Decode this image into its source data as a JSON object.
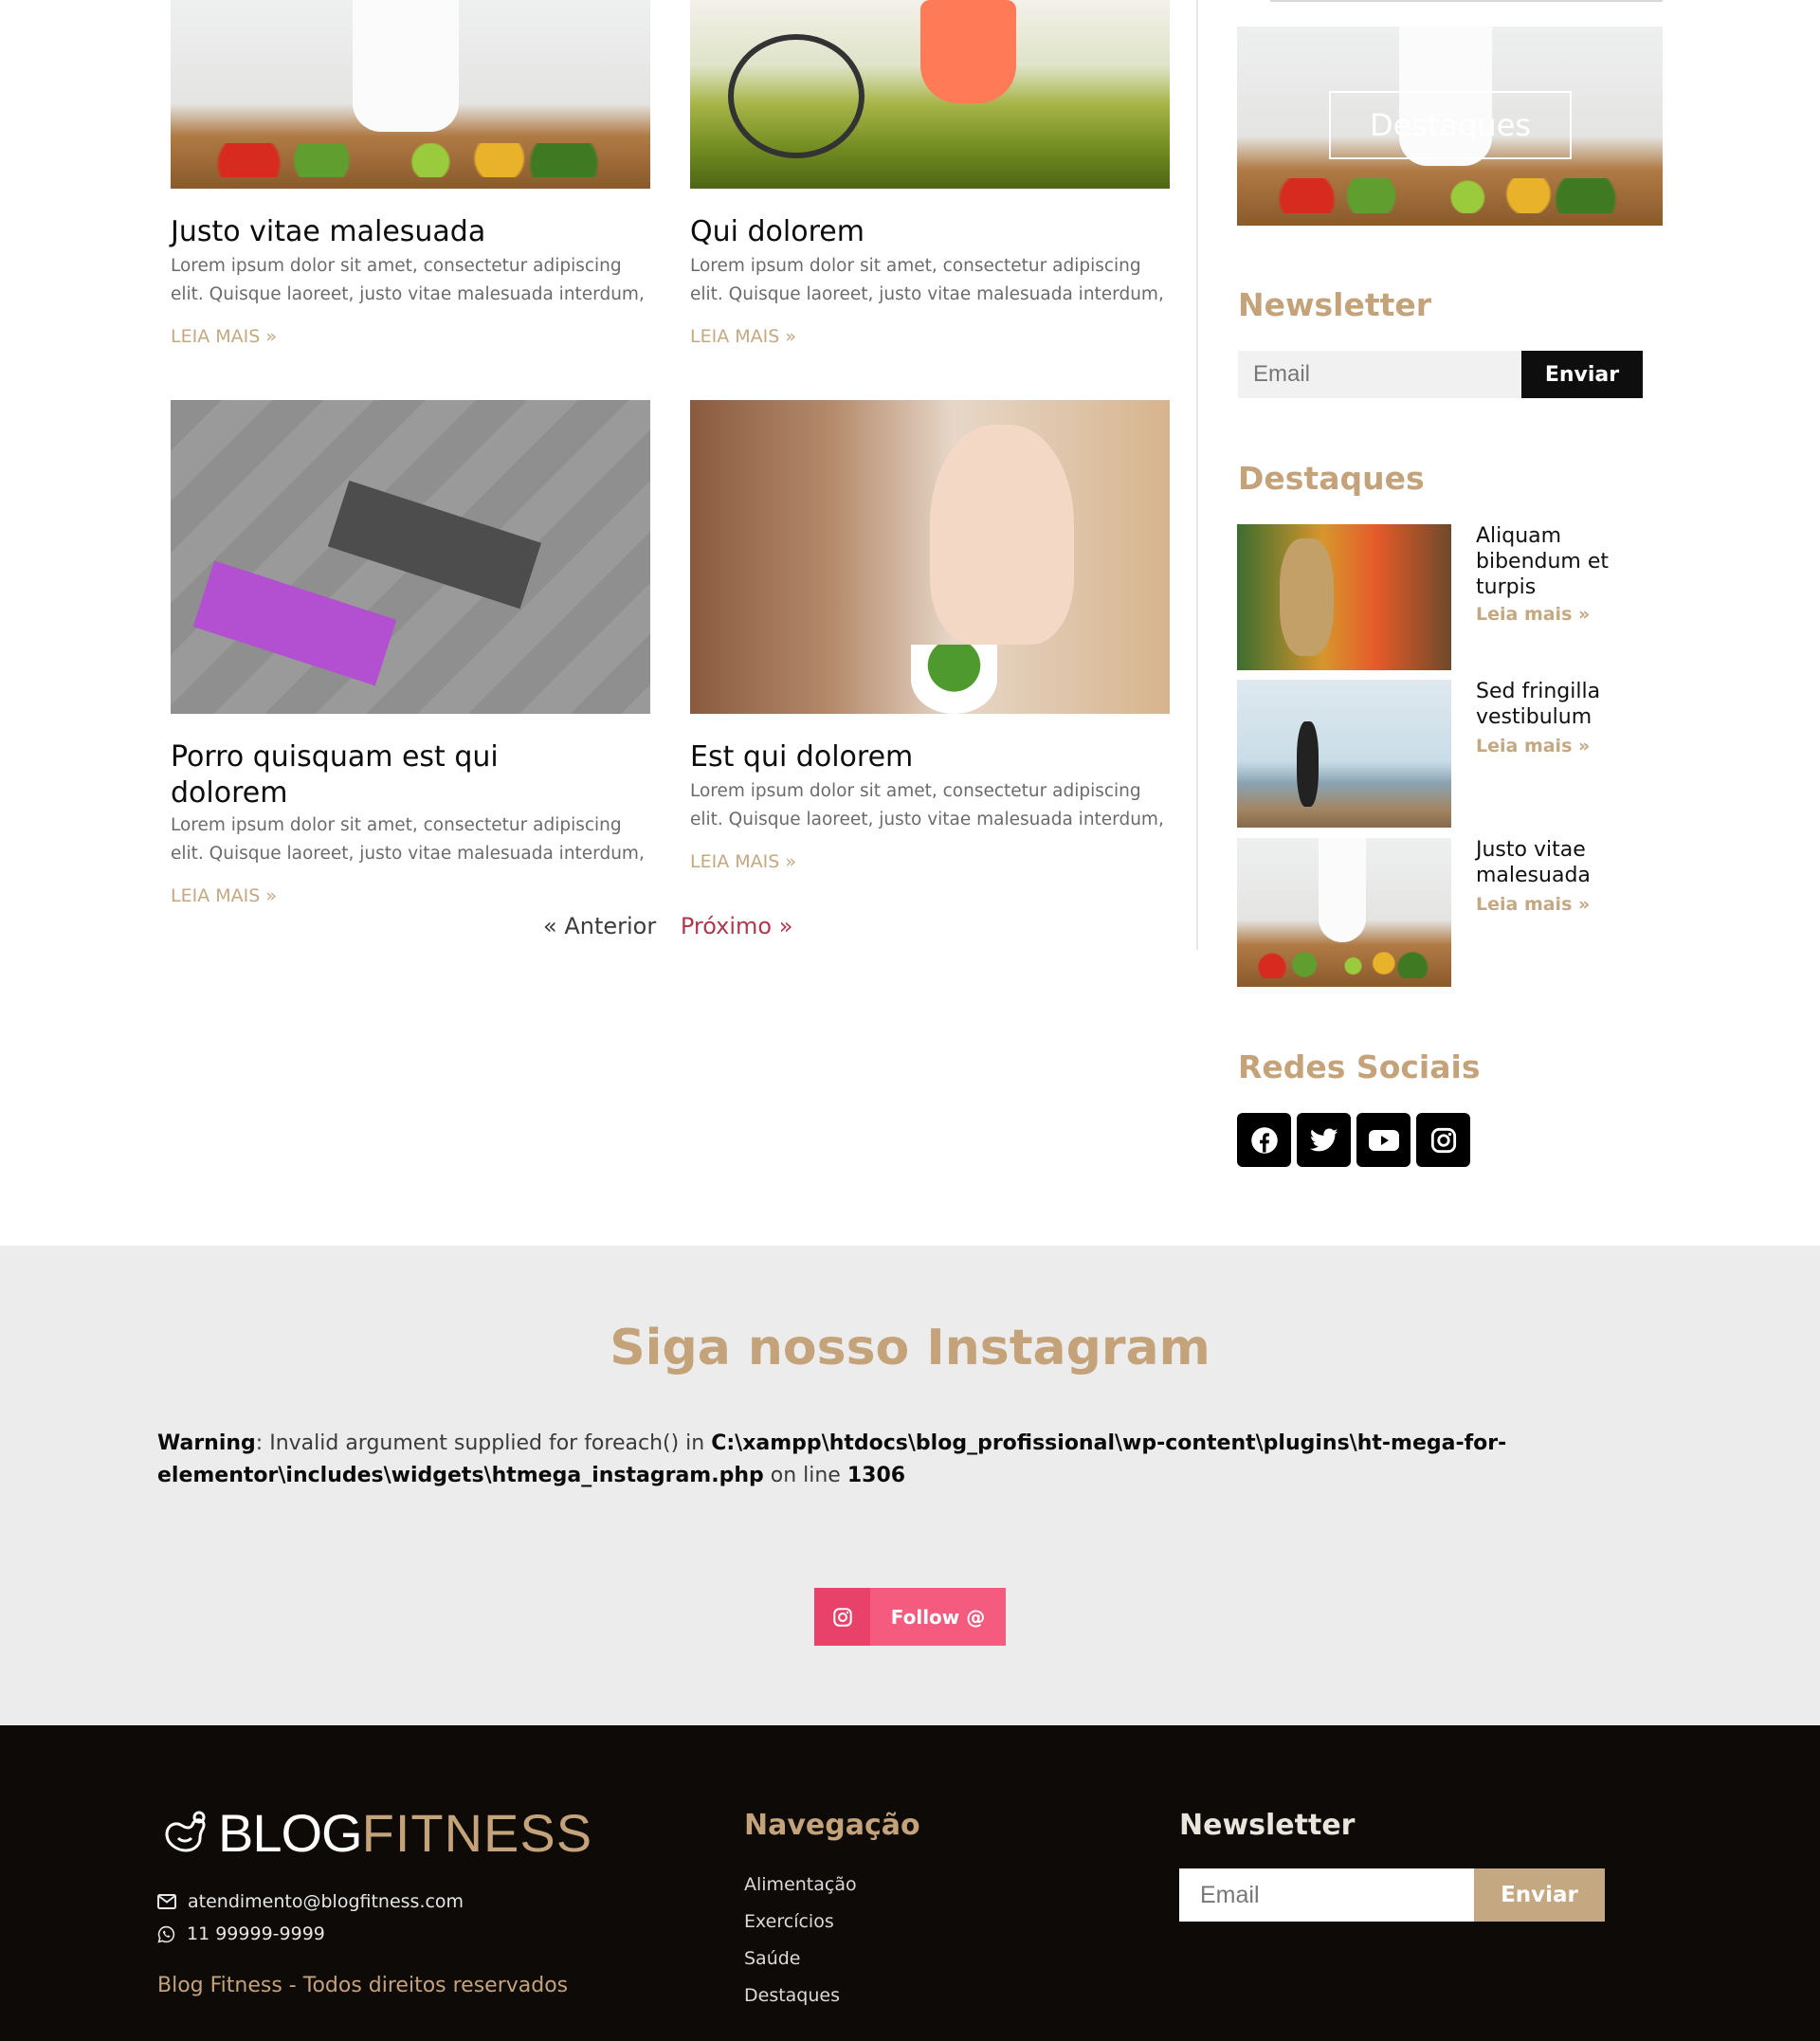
{
  "posts": [
    {
      "title": "Justo vitae malesuada",
      "excerpt": "Lorem ipsum dolor sit amet, consectetur adipiscing elit. Quisque laoreet, justo vitae malesuada interdum,",
      "read_more": "LEIA MAIS »"
    },
    {
      "title": "Qui dolorem",
      "excerpt": "Lorem ipsum dolor sit amet, consectetur adipiscing elit. Quisque laoreet, justo vitae malesuada interdum,",
      "read_more": "LEIA MAIS »"
    },
    {
      "title": "Porro quisquam est qui dolorem",
      "excerpt": "Lorem ipsum dolor sit amet, consectetur adipiscing elit. Quisque laoreet, justo vitae malesuada interdum,",
      "read_more": "LEIA MAIS »"
    },
    {
      "title": "Est qui dolorem",
      "excerpt": "Lorem ipsum dolor sit amet, consectetur adipiscing elit. Quisque laoreet, justo vitae malesuada interdum,",
      "read_more": "LEIA MAIS »"
    }
  ],
  "pagination": {
    "prev": "« Anterior",
    "next": "Próximo »"
  },
  "sidebar": {
    "banner_label": "Destaques",
    "newsletter": {
      "heading": "Newsletter",
      "placeholder": "Email",
      "submit": "Enviar"
    },
    "featured": {
      "heading": "Destaques",
      "items": [
        {
          "title": "Aliquam bibendum et turpis",
          "read_more": "Leia mais »"
        },
        {
          "title": "Sed fringilla vestibulum",
          "read_more": "Leia mais »"
        },
        {
          "title": "Justo vitae malesuada",
          "read_more": "Leia mais »"
        }
      ]
    },
    "social": {
      "heading": "Redes Sociais",
      "icons": [
        "facebook-icon",
        "twitter-icon",
        "youtube-icon",
        "instagram-icon"
      ]
    }
  },
  "instagram": {
    "heading": "Siga nosso Instagram",
    "warning_label": "Warning",
    "warning_text": ": Invalid argument supplied for foreach() in ",
    "warning_path": "C:\\xampp\\htdocs\\blog_profissional\\wp-content\\plugins\\ht-mega-for-elementor\\includes\\widgets\\htmega_instagram.php",
    "warning_online": " on line ",
    "warning_line": "1306",
    "follow_label": "Follow @"
  },
  "footer": {
    "logo_blog": "BLOG",
    "logo_fitness": "FITNESS",
    "email": "atendimento@blogfitness.com",
    "phone": "11 99999-9999",
    "copyright": "Blog Fitness - Todos direitos reservados",
    "nav_heading": "Navegação",
    "nav_links": [
      "Alimentação",
      "Exercícios",
      "Saúde",
      "Destaques"
    ],
    "newsletter_heading": "Newsletter",
    "newsletter_placeholder": "Email",
    "newsletter_submit": "Enviar"
  },
  "colors": {
    "accent_gold": "#c4a27a",
    "accent_pink": "#f45b7f",
    "footer_bg": "#0d0a08"
  }
}
